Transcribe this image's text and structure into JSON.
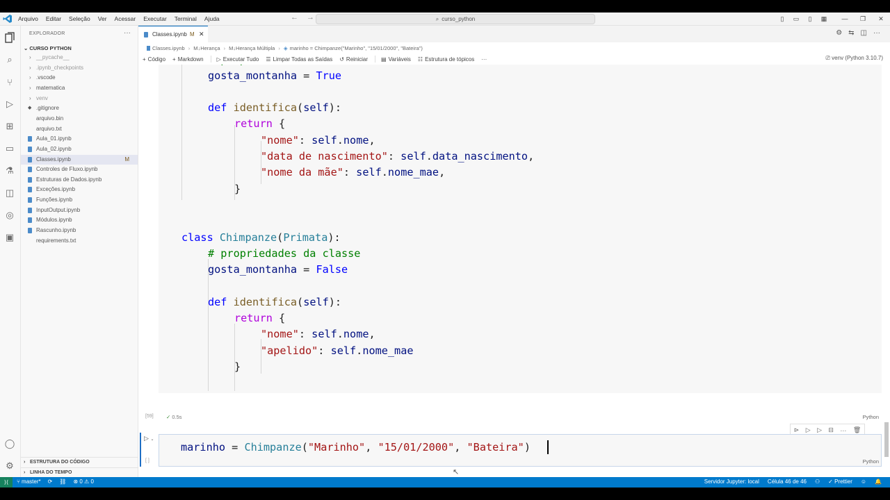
{
  "titlebar": {
    "menu": [
      "Arquivo",
      "Editar",
      "Seleção",
      "Ver",
      "Acessar",
      "Executar",
      "Terminal",
      "Ajuda"
    ],
    "search": "curso_python"
  },
  "sidebar": {
    "header": "EXPLORADOR",
    "project": "CURSO PYTHON",
    "items": [
      {
        "label": "__pycache__",
        "type": "folder"
      },
      {
        "label": ".ipynb_checkpoints",
        "type": "folder"
      },
      {
        "label": ".vscode",
        "type": "folder"
      },
      {
        "label": "matematica",
        "type": "folder"
      },
      {
        "label": "venv",
        "type": "folder"
      },
      {
        "label": ".gitignore",
        "type": "file"
      },
      {
        "label": "arquivo.bin",
        "type": "file"
      },
      {
        "label": "arquivo.txt",
        "type": "file"
      },
      {
        "label": "Aula_01.ipynb",
        "type": "nb"
      },
      {
        "label": "Aula_02.ipynb",
        "type": "nb"
      },
      {
        "label": "Classes.ipynb",
        "type": "nb",
        "badge": "M"
      },
      {
        "label": "Controles de Fluxo.ipynb",
        "type": "nb"
      },
      {
        "label": "Estruturas de Dados.ipynb",
        "type": "nb"
      },
      {
        "label": "Exceções.ipynb",
        "type": "nb"
      },
      {
        "label": "Funções.ipynb",
        "type": "nb"
      },
      {
        "label": "InputOutput.ipynb",
        "type": "nb"
      },
      {
        "label": "Módulos.ipynb",
        "type": "nb"
      },
      {
        "label": "Rascunho.ipynb",
        "type": "nb"
      },
      {
        "label": "requirements.txt",
        "type": "file"
      }
    ],
    "sections": [
      "ESTRUTURA DO CÓDIGO",
      "LINHA DO TEMPO"
    ]
  },
  "editor": {
    "tab": {
      "name": "Classes.ipynb",
      "badge": "M"
    },
    "breadcrumb": [
      "Classes.ipynb",
      "M↓Herança",
      "M↓Herança Múltipla",
      "marinho = Chimpanze(\"Marinho\", \"15/01/2000\", \"Bateira\")"
    ],
    "toolbar": [
      "Código",
      "Markdown",
      "Executar Tudo",
      "Limpar Todas as Saídas",
      "Reiniciar",
      "Variáveis",
      "Estrutura de tópicos"
    ],
    "toolbar_more": "···",
    "kernel": "venv (Python 3.10.7)",
    "cell1": {
      "exec_count": "[59]",
      "time": "0.5s",
      "lang": "Python"
    },
    "cell2": {
      "exec_count": "[ ]",
      "lang": "Python"
    }
  },
  "statusbar": {
    "branch": "master*",
    "problems": "⊗ 0 ⚠ 0",
    "jupyter": "Servidor Jupyter: local",
    "cell": "Célula 46 de 46",
    "prettier": "✓ Prettier"
  },
  "colors": {
    "accent": "#007acc",
    "remote": "#16825d"
  }
}
